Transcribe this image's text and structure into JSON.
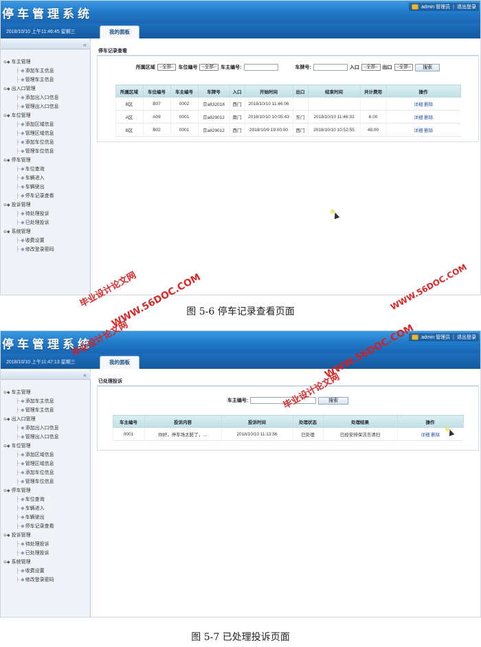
{
  "app": {
    "title": "停车管理系统",
    "user_label": "admin 管理员",
    "separator": "|",
    "logout_label": "退出登录"
  },
  "menu": [
    {
      "label": "车主管理",
      "children": [
        "添加车主信息",
        "管理车主信息"
      ]
    },
    {
      "label": "出入口管理",
      "children": [
        "添加出入口信息",
        "管理出入口信息"
      ]
    },
    {
      "label": "车位管理",
      "children": [
        "添加区域信息",
        "管理区域信息",
        "添加车位信息",
        "管理车位信息"
      ]
    },
    {
      "label": "停车管理",
      "children": [
        "车位查询",
        "车辆进入",
        "车辆驶出",
        "停车记录查看"
      ]
    },
    {
      "label": "投诉管理",
      "children": [
        "待处理投诉",
        "已处理投诉"
      ]
    },
    {
      "label": "系统管理",
      "children": [
        "收费设置",
        "修改登录密码"
      ]
    }
  ],
  "collapse_icon": "«",
  "screen1": {
    "datetime": "2018/10/10 上午11:46:45 星期三",
    "tab_label": "我的面板",
    "panel_title": "停车记录查看",
    "search": {
      "area_label": "所属区域",
      "area_value": "--全部--",
      "spot_label": "车位编号",
      "spot_value": "--全部--",
      "owner_label": "车主编号:",
      "plate_label": "车牌号:",
      "entry_label": "入口",
      "entry_value": "--全部--",
      "exit_label": "出口",
      "exit_value": "--全部--",
      "button": "搜索"
    },
    "columns": [
      "所属区域",
      "车位编号",
      "车主编号",
      "车牌号",
      "入口",
      "开始时间",
      "出口",
      "结束时间",
      "共计费用",
      "操作"
    ],
    "rows": [
      [
        "B区",
        "B07",
        "0002",
        "京a832018",
        "西门",
        "2018/10/10 11:46:06",
        "",
        "",
        "",
        ""
      ],
      [
        "A区",
        "A09",
        "0001",
        "京a829012",
        "南门",
        "2018/10/10 10:05:43",
        "东门",
        "2018/10/10 11:46:33",
        "6.00",
        ""
      ],
      [
        "B区",
        "B02",
        "0001",
        "京a829012",
        "西门",
        "2018/10/9 19:00:00",
        "西门",
        "2018/10/10 10:52:55",
        "48.00",
        ""
      ]
    ],
    "op_detail": "详细",
    "op_delete": "删除"
  },
  "caption1": "图 5-6 停车记录查看页面",
  "screen2": {
    "datetime": "2018/10/10 上午11:47:13 星期三",
    "tab_label": "我的面板",
    "panel_title": "已处理投诉",
    "search": {
      "owner_label": "车主编号:",
      "button": "搜索"
    },
    "columns": [
      "车主编号",
      "投诉内容",
      "投诉时间",
      "处理状态",
      "处理结果",
      "操作"
    ],
    "rows": [
      [
        "0001",
        "你好，停车场太脏了，…",
        "2018/10/10 11:13:56",
        "已处理",
        "已经安排保洁去清扫",
        ""
      ]
    ],
    "op_detail": "详细",
    "op_delete": "删除"
  },
  "caption2": "图 5-7 已处理投诉页面",
  "watermark": {
    "cn": "毕业设计论文网",
    "en": "WWW.56DOC.COM"
  },
  "colors": {
    "header_blue": "#1f78c8",
    "watermark_red": "#d81e1e",
    "table_header": "#bfe0e6"
  }
}
